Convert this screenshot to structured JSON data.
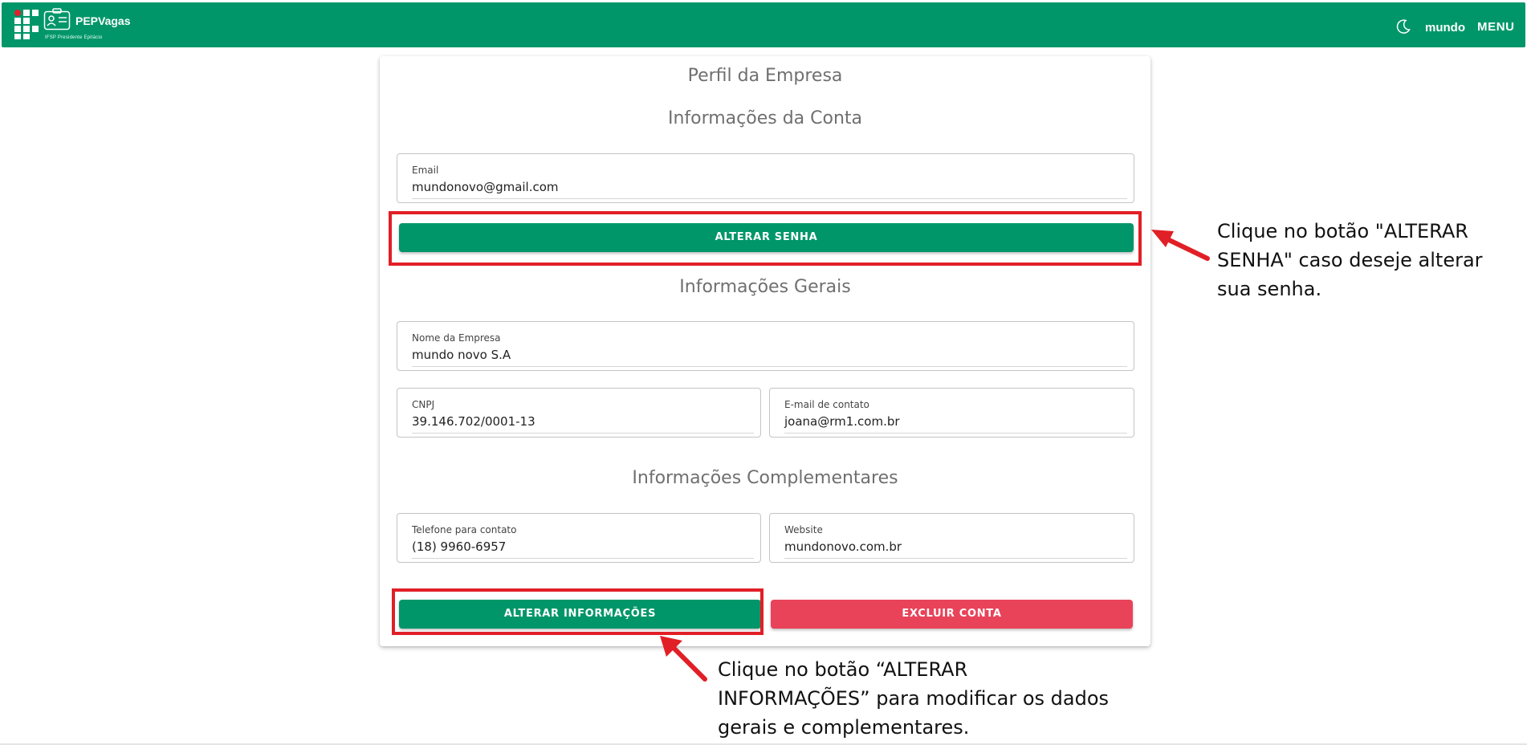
{
  "header": {
    "brand_title": "PEPVagas",
    "brand_subtitle": "IFSP Presidente Epitácio",
    "user_name": "mundo",
    "menu_label": "MENU",
    "color": "#019669"
  },
  "card": {
    "title": "Perfil da Empresa",
    "account_section": "Informações da Conta",
    "email": {
      "label": "Email",
      "value": "mundonovo@gmail.com"
    },
    "change_password_label": "ALTERAR SENHA",
    "general_section": "Informações Gerais",
    "company_name": {
      "label": "Nome da Empresa",
      "value": "mundo novo S.A"
    },
    "cnpj": {
      "label": "CNPJ",
      "value": "39.146.702/0001-13"
    },
    "contact_email": {
      "label": "E-mail de contato",
      "value": "joana@rm1.com.br"
    },
    "complementary_section": "Informações Complementares",
    "phone": {
      "label": "Telefone para contato",
      "value": "(18) 9960-6957"
    },
    "website": {
      "label": "Website",
      "value": "mundonovo.com.br"
    },
    "update_info_label": "ALTERAR INFORMAÇÕES",
    "delete_account_label": "EXCLUIR CONTA",
    "delete_color": "#e9435a"
  },
  "annotations": {
    "password_note_lines": [
      "Clique no botão \"ALTERAR",
      "SENHA\" caso deseje alterar",
      "sua senha."
    ],
    "update_note_lines": [
      "Clique no botão “ALTERAR",
      "INFORMAÇÕES” para modificar os dados",
      "gerais e complementares."
    ],
    "highlight_color": "#e11f26"
  }
}
